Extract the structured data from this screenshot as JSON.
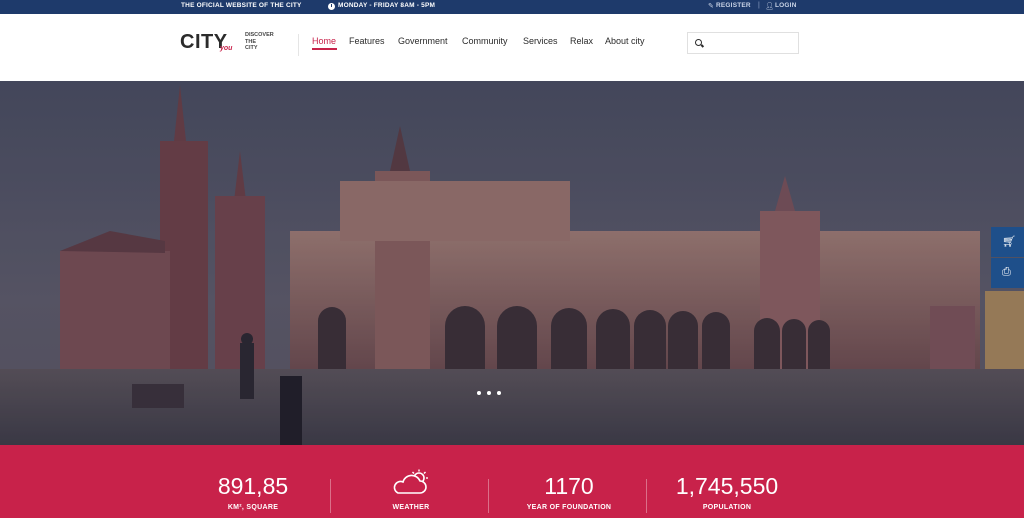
{
  "topbar": {
    "official": "THE OFICIAL WEBSITE OF THE CITY",
    "hours": "MONDAY - FRIDAY 8AM - 5PM",
    "register": "REGISTER",
    "separator": "|",
    "login": "LOGIN",
    "bg_color": "#1e3a6b"
  },
  "header": {
    "logo_main": "CITY",
    "logo_sub": "you",
    "tagline_1": "DISCOVER",
    "tagline_2": "THE",
    "tagline_3": "CITY",
    "nav": [
      "Home",
      "Features",
      "Government",
      "Community",
      "Services",
      "Relax",
      "About city"
    ],
    "active_nav": "Home",
    "search_placeholder": "",
    "accent_color": "#c8224a"
  },
  "hero": {
    "slide_count": 3,
    "active_slide": 1
  },
  "side_tools": {
    "cart_icon": "cart-icon",
    "print_icon": "print-icon",
    "color": "#1e4f8a"
  },
  "stats": {
    "items": [
      {
        "value": "891,85",
        "label": "KM², SQUARE"
      },
      {
        "value": "",
        "label": "WEATHER",
        "icon": "cloud-sun-icon"
      },
      {
        "value": "1170",
        "label": "YEAR OF FOUNDATION"
      },
      {
        "value": "1,745,550",
        "label": "POPULATION"
      }
    ],
    "bg_color": "#c8224a"
  }
}
